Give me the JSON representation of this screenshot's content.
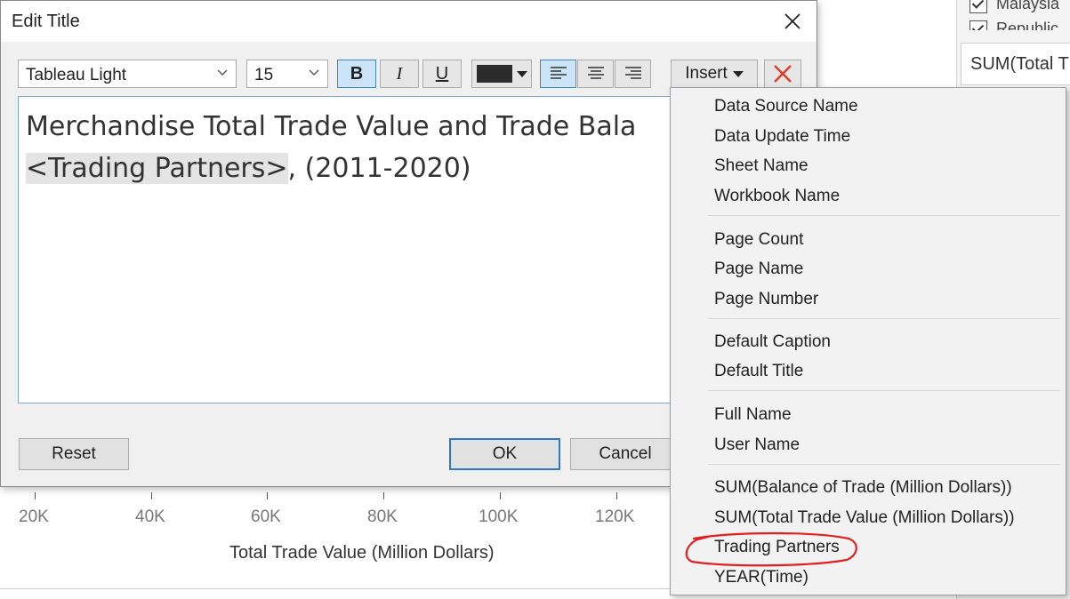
{
  "background": {
    "legend_items": [
      "Malaysia",
      "Republic"
    ],
    "measure_card_label": "SUM(Total T",
    "x_axis": {
      "tick_labels": [
        "20K",
        "40K",
        "60K",
        "80K",
        "100K",
        "120K"
      ],
      "title": "Total Trade Value (Million Dollars)"
    }
  },
  "dialog": {
    "title": "Edit Title",
    "close_icon": "close-icon",
    "toolbar": {
      "font_family": "Tableau Light",
      "font_size": "15",
      "bold_label": "B",
      "italic_label": "I",
      "underline_label": "U",
      "text_color": "#2b2b2b",
      "insert_label": "Insert",
      "clear_icon": "red-x-icon"
    },
    "editor": {
      "line1": "Merchandise Total Trade Value and Trade Bala",
      "field_token": "<Trading Partners>",
      "line2_suffix": ", (2011-2020)"
    },
    "buttons": {
      "reset": "Reset",
      "ok": "OK",
      "cancel": "Cancel"
    }
  },
  "insert_menu": {
    "groups": [
      [
        "Data Source Name",
        "Data Update Time",
        "Sheet Name",
        "Workbook Name"
      ],
      [
        "Page Count",
        "Page Name",
        "Page Number"
      ],
      [
        "Default Caption",
        "Default Title"
      ],
      [
        "Full Name",
        "User Name"
      ],
      [
        "SUM(Balance of Trade (Million Dollars))",
        "SUM(Total Trade Value (Million Dollars))",
        "Trading Partners",
        "YEAR(Time)"
      ]
    ],
    "highlighted_item": "Trading Partners",
    "highlight_color": "#e02020"
  },
  "colors": {
    "accent": "#2f78c4",
    "selected_button_bg": "#cce4f7"
  }
}
